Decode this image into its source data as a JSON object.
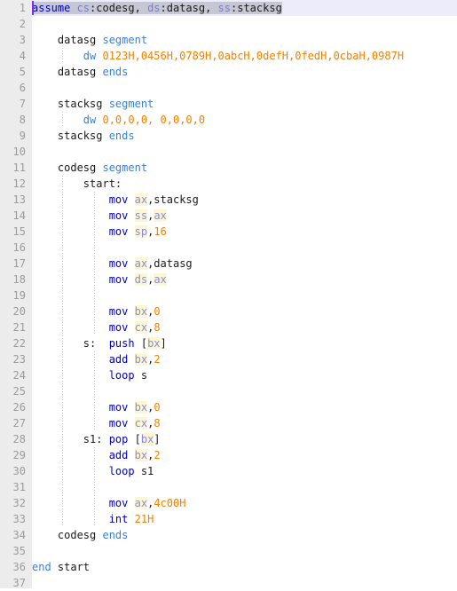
{
  "editor": {
    "name": "assembly-code-editor",
    "total_lines": 37,
    "colors": {
      "background": "#ffffff",
      "gutter_background": "#ececec",
      "gutter_text": "#9a9a9a",
      "current_line": "#ececfa",
      "selection": "#c6c7d4",
      "caret": "#7b2ff2",
      "keyword": "#0000c0",
      "directive": "#3a7fd5",
      "register": "#8a8ad8",
      "register_highlight": "#fdf7cf",
      "number": "#f08000",
      "plain_text": "#1a1a1a",
      "indent_guide": "#c8c8c8"
    },
    "line_numbers": [
      "1",
      "2",
      "3",
      "4",
      "5",
      "6",
      "7",
      "8",
      "9",
      "10",
      "11",
      "12",
      "13",
      "14",
      "15",
      "16",
      "17",
      "18",
      "19",
      "20",
      "21",
      "22",
      "23",
      "24",
      "25",
      "26",
      "27",
      "28",
      "29",
      "30",
      "31",
      "32",
      "33",
      "34",
      "35",
      "36",
      "37"
    ],
    "lines": [
      {
        "n": 1,
        "selected": true,
        "caret": true,
        "guides": [],
        "tokens": [
          {
            "t": "assume ",
            "c": "dir"
          },
          {
            "t": "cs",
            "c": "reg"
          },
          {
            "t": ":codesg, ",
            "c": "plain"
          },
          {
            "t": "ds",
            "c": "reg"
          },
          {
            "t": ":datasg, ",
            "c": "plain"
          },
          {
            "t": "ss",
            "c": "reg"
          },
          {
            "t": ":stacksg",
            "c": "plain"
          }
        ]
      },
      {
        "n": 2,
        "guides": [],
        "tokens": []
      },
      {
        "n": 3,
        "guides": [],
        "tokens": [
          {
            "t": "    datasg ",
            "c": "plain"
          },
          {
            "t": "segment",
            "c": "dir"
          }
        ]
      },
      {
        "n": 4,
        "guides": [
          34
        ],
        "tokens": [
          {
            "t": "        ",
            "c": "plain"
          },
          {
            "t": "dw",
            "c": "dir"
          },
          {
            "t": " ",
            "c": "plain"
          },
          {
            "t": "0123H,0456H,0789H,0abcH,0defH,0fedH,0cbaH,0987H",
            "c": "num"
          }
        ]
      },
      {
        "n": 5,
        "guides": [],
        "tokens": [
          {
            "t": "    datasg ",
            "c": "plain"
          },
          {
            "t": "ends",
            "c": "dir"
          }
        ]
      },
      {
        "n": 6,
        "guides": [],
        "tokens": []
      },
      {
        "n": 7,
        "guides": [],
        "tokens": [
          {
            "t": "    stacksg ",
            "c": "plain"
          },
          {
            "t": "segment",
            "c": "dir"
          }
        ]
      },
      {
        "n": 8,
        "guides": [
          34
        ],
        "tokens": [
          {
            "t": "        ",
            "c": "plain"
          },
          {
            "t": "dw",
            "c": "dir"
          },
          {
            "t": " ",
            "c": "plain"
          },
          {
            "t": "0,0,0,0, 0,0,0,0",
            "c": "num"
          }
        ]
      },
      {
        "n": 9,
        "guides": [],
        "tokens": [
          {
            "t": "    stacksg ",
            "c": "plain"
          },
          {
            "t": "ends",
            "c": "dir"
          }
        ]
      },
      {
        "n": 10,
        "guides": [],
        "tokens": []
      },
      {
        "n": 11,
        "guides": [],
        "tokens": [
          {
            "t": "    codesg ",
            "c": "plain"
          },
          {
            "t": "segment",
            "c": "dir"
          }
        ]
      },
      {
        "n": 12,
        "guides": [
          34
        ],
        "tokens": [
          {
            "t": "        start:",
            "c": "plain"
          }
        ]
      },
      {
        "n": 13,
        "guides": [
          34,
          70
        ],
        "tokens": [
          {
            "t": "            ",
            "c": "plain"
          },
          {
            "t": "mov",
            "c": "kw"
          },
          {
            "t": " ",
            "c": "plain"
          },
          {
            "t": "ax",
            "c": "reg"
          },
          {
            "t": ",stacksg",
            "c": "plain"
          }
        ]
      },
      {
        "n": 14,
        "guides": [
          34,
          70
        ],
        "tokens": [
          {
            "t": "            ",
            "c": "plain"
          },
          {
            "t": "mov",
            "c": "kw"
          },
          {
            "t": " ",
            "c": "plain"
          },
          {
            "t": "ss",
            "c": "reg"
          },
          {
            "t": ",",
            "c": "plain"
          },
          {
            "t": "ax",
            "c": "reg"
          }
        ]
      },
      {
        "n": 15,
        "guides": [
          34,
          70
        ],
        "tokens": [
          {
            "t": "            ",
            "c": "plain"
          },
          {
            "t": "mov",
            "c": "kw"
          },
          {
            "t": " ",
            "c": "plain"
          },
          {
            "t": "sp",
            "c": "reg"
          },
          {
            "t": ",",
            "c": "plain"
          },
          {
            "t": "16",
            "c": "num"
          }
        ]
      },
      {
        "n": 16,
        "guides": [
          34,
          70
        ],
        "tokens": []
      },
      {
        "n": 17,
        "guides": [
          34,
          70
        ],
        "tokens": [
          {
            "t": "            ",
            "c": "plain"
          },
          {
            "t": "mov",
            "c": "kw"
          },
          {
            "t": " ",
            "c": "plain"
          },
          {
            "t": "ax",
            "c": "reg"
          },
          {
            "t": ",datasg",
            "c": "plain"
          }
        ]
      },
      {
        "n": 18,
        "guides": [
          34,
          70
        ],
        "tokens": [
          {
            "t": "            ",
            "c": "plain"
          },
          {
            "t": "mov",
            "c": "kw"
          },
          {
            "t": " ",
            "c": "plain"
          },
          {
            "t": "ds",
            "c": "reg"
          },
          {
            "t": ",",
            "c": "plain"
          },
          {
            "t": "ax",
            "c": "reg"
          }
        ]
      },
      {
        "n": 19,
        "guides": [
          34,
          70
        ],
        "tokens": []
      },
      {
        "n": 20,
        "guides": [
          34,
          70
        ],
        "tokens": [
          {
            "t": "            ",
            "c": "plain"
          },
          {
            "t": "mov",
            "c": "kw"
          },
          {
            "t": " ",
            "c": "plain"
          },
          {
            "t": "bx",
            "c": "reg"
          },
          {
            "t": ",",
            "c": "plain"
          },
          {
            "t": "0",
            "c": "num"
          }
        ]
      },
      {
        "n": 21,
        "guides": [
          34,
          70
        ],
        "tokens": [
          {
            "t": "            ",
            "c": "plain"
          },
          {
            "t": "mov",
            "c": "kw"
          },
          {
            "t": " ",
            "c": "plain"
          },
          {
            "t": "cx",
            "c": "reg"
          },
          {
            "t": ",",
            "c": "plain"
          },
          {
            "t": "8",
            "c": "num"
          }
        ]
      },
      {
        "n": 22,
        "guides": [
          34
        ],
        "tokens": [
          {
            "t": "        s:  ",
            "c": "plain"
          },
          {
            "t": "push",
            "c": "kw"
          },
          {
            "t": " [",
            "c": "plain"
          },
          {
            "t": "bx",
            "c": "reg"
          },
          {
            "t": "]",
            "c": "plain"
          }
        ]
      },
      {
        "n": 23,
        "guides": [
          34,
          70
        ],
        "tokens": [
          {
            "t": "            ",
            "c": "plain"
          },
          {
            "t": "add",
            "c": "kw"
          },
          {
            "t": " ",
            "c": "plain"
          },
          {
            "t": "bx",
            "c": "reg"
          },
          {
            "t": ",",
            "c": "plain"
          },
          {
            "t": "2",
            "c": "num"
          }
        ]
      },
      {
        "n": 24,
        "guides": [
          34,
          70
        ],
        "tokens": [
          {
            "t": "            ",
            "c": "plain"
          },
          {
            "t": "loop",
            "c": "kw"
          },
          {
            "t": " s",
            "c": "plain"
          }
        ]
      },
      {
        "n": 25,
        "guides": [
          34,
          70
        ],
        "tokens": []
      },
      {
        "n": 26,
        "guides": [
          34,
          70
        ],
        "tokens": [
          {
            "t": "            ",
            "c": "plain"
          },
          {
            "t": "mov",
            "c": "kw"
          },
          {
            "t": " ",
            "c": "plain"
          },
          {
            "t": "bx",
            "c": "reg"
          },
          {
            "t": ",",
            "c": "plain"
          },
          {
            "t": "0",
            "c": "num"
          }
        ]
      },
      {
        "n": 27,
        "guides": [
          34,
          70
        ],
        "tokens": [
          {
            "t": "            ",
            "c": "plain"
          },
          {
            "t": "mov",
            "c": "kw"
          },
          {
            "t": " ",
            "c": "plain"
          },
          {
            "t": "cx",
            "c": "reg"
          },
          {
            "t": ",",
            "c": "plain"
          },
          {
            "t": "8",
            "c": "num"
          }
        ]
      },
      {
        "n": 28,
        "guides": [
          34
        ],
        "tokens": [
          {
            "t": "        s1: ",
            "c": "plain"
          },
          {
            "t": "pop",
            "c": "kw"
          },
          {
            "t": " [",
            "c": "plain"
          },
          {
            "t": "bx",
            "c": "reg"
          },
          {
            "t": "]",
            "c": "plain"
          }
        ]
      },
      {
        "n": 29,
        "guides": [
          34,
          70
        ],
        "tokens": [
          {
            "t": "            ",
            "c": "plain"
          },
          {
            "t": "add",
            "c": "kw"
          },
          {
            "t": " ",
            "c": "plain"
          },
          {
            "t": "bx",
            "c": "reg"
          },
          {
            "t": ",",
            "c": "plain"
          },
          {
            "t": "2",
            "c": "num"
          }
        ]
      },
      {
        "n": 30,
        "guides": [
          34,
          70
        ],
        "tokens": [
          {
            "t": "            ",
            "c": "plain"
          },
          {
            "t": "loop",
            "c": "kw"
          },
          {
            "t": " s1",
            "c": "plain"
          }
        ]
      },
      {
        "n": 31,
        "guides": [
          34,
          70
        ],
        "tokens": []
      },
      {
        "n": 32,
        "guides": [
          34,
          70
        ],
        "tokens": [
          {
            "t": "            ",
            "c": "plain"
          },
          {
            "t": "mov",
            "c": "kw"
          },
          {
            "t": " ",
            "c": "plain"
          },
          {
            "t": "ax",
            "c": "reg"
          },
          {
            "t": ",",
            "c": "plain"
          },
          {
            "t": "4c00H",
            "c": "num"
          }
        ]
      },
      {
        "n": 33,
        "guides": [
          34,
          70
        ],
        "tokens": [
          {
            "t": "            ",
            "c": "plain"
          },
          {
            "t": "int",
            "c": "kw"
          },
          {
            "t": " ",
            "c": "plain"
          },
          {
            "t": "21H",
            "c": "num"
          }
        ]
      },
      {
        "n": 34,
        "guides": [],
        "tokens": [
          {
            "t": "    codesg ",
            "c": "plain"
          },
          {
            "t": "ends",
            "c": "dir"
          }
        ]
      },
      {
        "n": 35,
        "guides": [],
        "tokens": []
      },
      {
        "n": 36,
        "guides": [],
        "tokens": [
          {
            "t": "end",
            "c": "dir"
          },
          {
            "t": " start",
            "c": "plain"
          }
        ]
      },
      {
        "n": 37,
        "guides": [],
        "tokens": []
      }
    ]
  }
}
